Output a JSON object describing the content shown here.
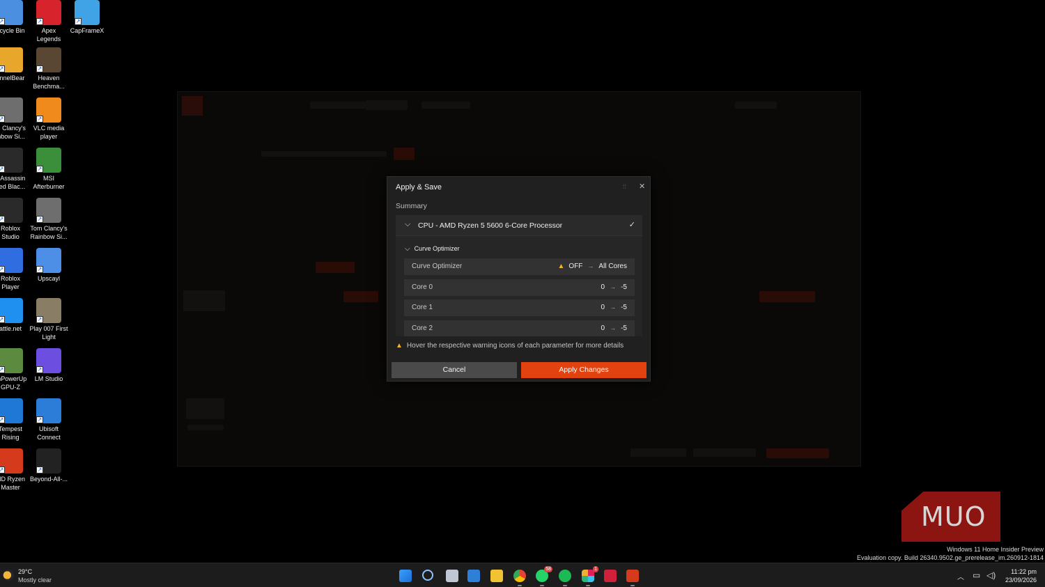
{
  "desktop": {
    "icons": [
      {
        "label": "ecycle Bin",
        "color": "#4a8fe0",
        "icon": "recycle-bin-icon"
      },
      {
        "label": "Apex\nLegends",
        "color": "#d7232c",
        "icon": "apex-legends-icon"
      },
      {
        "label": "CapFrameX",
        "color": "#3fa3e6",
        "icon": "capframex-icon"
      },
      {
        "label": "unnelBear",
        "color": "#e8a62a",
        "icon": "tunnelbear-icon"
      },
      {
        "label": "Heaven\nBenchma...",
        "color": "#5a4733",
        "icon": "heaven-benchmark-icon"
      },
      {
        "label": "m Clancy's\ninbow Si...",
        "color": "#6e6e6e",
        "icon": "rainbow-six-icon"
      },
      {
        "label": "VLC media\nplayer",
        "color": "#f08a1c",
        "icon": "vlc-icon"
      },
      {
        "label": "y Assassin\need Blac...",
        "color": "#2a2a2a",
        "icon": "assassins-creed-icon"
      },
      {
        "label": "MSI\nAfterburner",
        "color": "#3b8f3b",
        "icon": "msi-afterburner-icon"
      },
      {
        "label": "Roblox\nStudio",
        "color": "#2a2a2a",
        "icon": "roblox-studio-icon"
      },
      {
        "label": "Tom Clancy's\nRainbow Si...",
        "color": "#6e6e6e",
        "icon": "rainbow-six-icon"
      },
      {
        "label": "Roblox\nPlayer",
        "color": "#2f6de0",
        "icon": "roblox-player-icon"
      },
      {
        "label": "Upscayl",
        "color": "#4d8fe6",
        "icon": "upscayl-icon"
      },
      {
        "label": "attle.net",
        "color": "#1f8ff0",
        "icon": "battlenet-icon"
      },
      {
        "label": "Play 007 First\nLight",
        "color": "#8a7d66",
        "icon": "007-first-light-icon"
      },
      {
        "label": "chPowerUp\nGPU-Z",
        "color": "#5c8a3e",
        "icon": "gpu-z-icon"
      },
      {
        "label": "LM Studio",
        "color": "#6c4fe0",
        "icon": "lm-studio-icon"
      },
      {
        "label": "Tempest\nRising",
        "color": "#1f78d6",
        "icon": "tempest-rising-icon"
      },
      {
        "label": "Ubisoft\nConnect",
        "color": "#2b7dd8",
        "icon": "ubisoft-connect-icon"
      },
      {
        "label": "MD Ryzen\nMaster",
        "color": "#d63a1c",
        "icon": "ryzen-master-icon"
      },
      {
        "label": "Beyond-All-...",
        "color": "#222",
        "icon": "beyond-all-reason-icon"
      }
    ]
  },
  "dialog": {
    "title": "Apply & Save",
    "summary_label": "Summary",
    "cpu_label": "CPU - AMD Ryzen 5 5600 6-Core Processor",
    "section_label": "Curve Optimizer",
    "rows": [
      {
        "name": "Curve Optimizer",
        "warn": true,
        "from": "OFF",
        "to": "All Cores"
      },
      {
        "name": "Core 0",
        "warn": false,
        "from": "0",
        "to": "-5"
      },
      {
        "name": "Core 1",
        "warn": false,
        "from": "0",
        "to": "-5"
      },
      {
        "name": "Core 2",
        "warn": false,
        "from": "0",
        "to": "-5"
      }
    ],
    "note": "Hover the respective warning icons of each parameter for more details",
    "cancel_label": "Cancel",
    "apply_label": "Apply Changes",
    "accent": "#e2420f",
    "warn_color": "#f4b81e"
  },
  "watermark": {
    "logo_text": "MUO",
    "line1": "Windows 11 Home Insider Preview",
    "line2": "Evaluation copy. Build 26340.9502.ge_prerelease_im.260912-1814"
  },
  "taskbar": {
    "weather_temp": "29°C",
    "weather_desc": "Mostly clear",
    "whatsapp_badge": "58",
    "slack_badge": "1",
    "time": "11:22 pm",
    "date": "23/09/2026"
  }
}
